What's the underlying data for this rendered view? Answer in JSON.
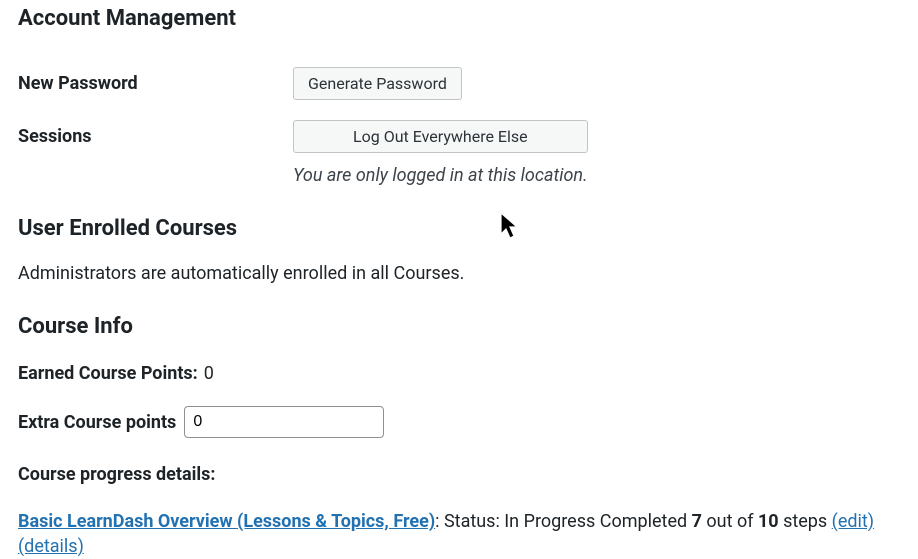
{
  "account": {
    "heading": "Account Management",
    "new_password_label": "New Password",
    "generate_password_label": "Generate Password",
    "sessions_label": "Sessions",
    "logout_label": "Log Out Everywhere Else",
    "session_note": "You are only logged in at this location."
  },
  "enrolled": {
    "heading": "User Enrolled Courses",
    "admin_note": "Administrators are automatically enrolled in all Courses."
  },
  "course_info": {
    "heading": "Course Info",
    "earned_label": "Earned Course Points:",
    "earned_value": "0",
    "extra_label": "Extra Course points",
    "extra_value": "0",
    "progress_heading": "Course progress details:"
  },
  "courses": {
    "item1": {
      "name": "Basic LearnDash Overview (Lessons & Topics, Free)",
      "status_prefix": ": Status: In Progress Completed ",
      "completed": "7",
      "middle": " out of ",
      "total": "10",
      "suffix": " steps ",
      "edit": "(edit)",
      "details": "(details)"
    }
  }
}
